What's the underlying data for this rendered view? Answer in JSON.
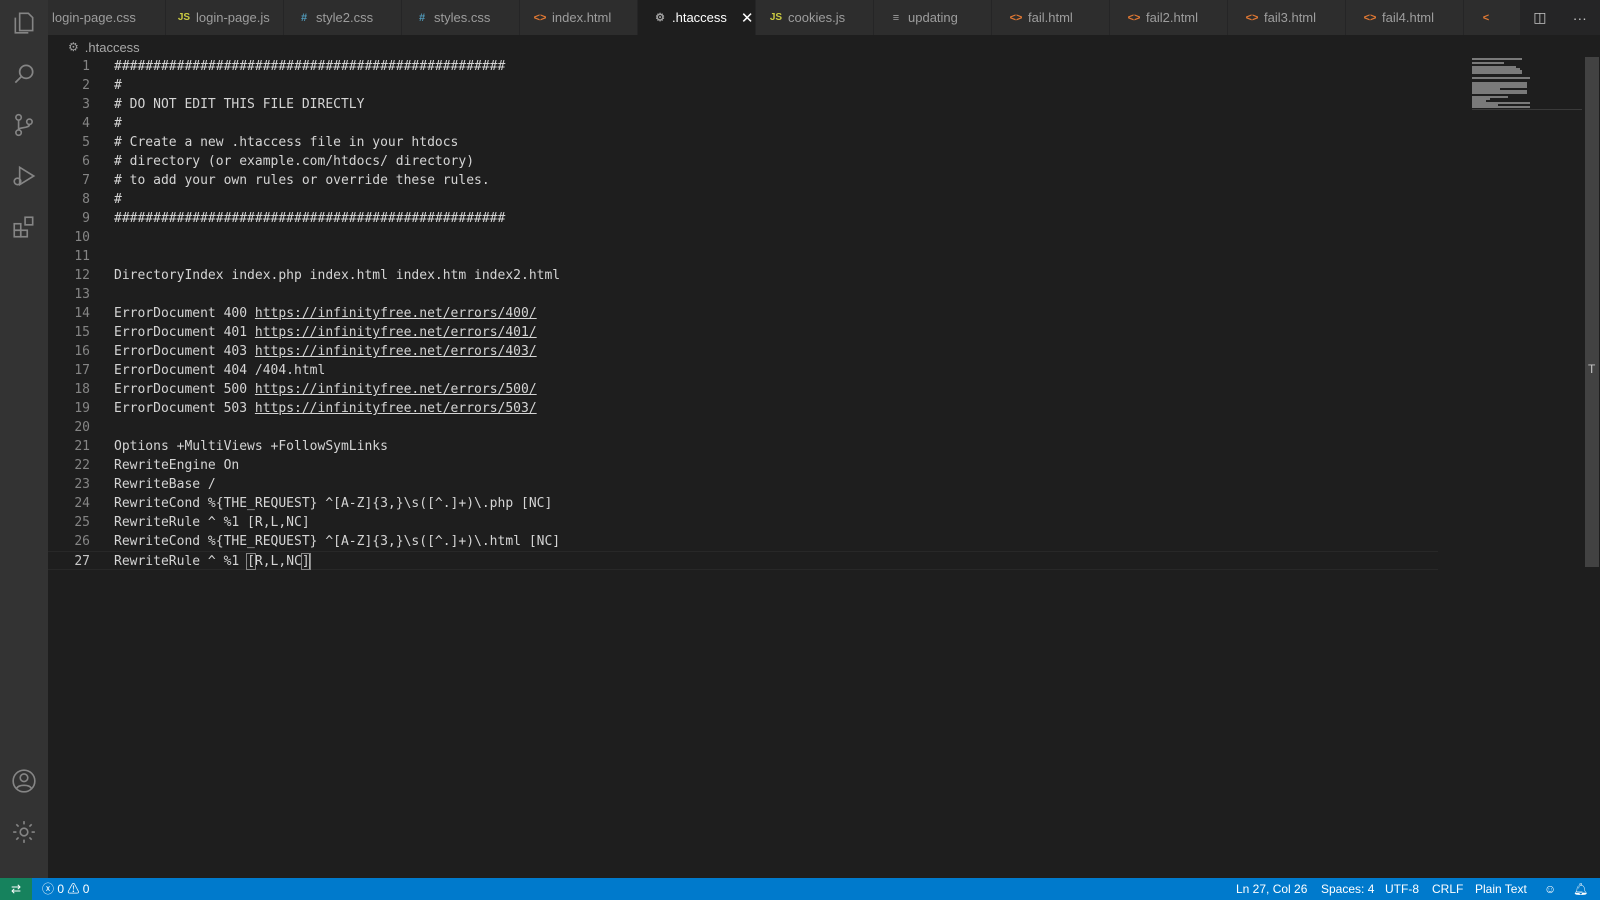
{
  "tabs": [
    {
      "label": "login-page.css",
      "icon": "css"
    },
    {
      "label": "login-page.js",
      "icon": "js"
    },
    {
      "label": "style2.css",
      "icon": "css"
    },
    {
      "label": "styles.css",
      "icon": "css"
    },
    {
      "label": "index.html",
      "icon": "html"
    },
    {
      "label": ".htaccess",
      "icon": "gear",
      "active": true
    },
    {
      "label": "cookies.js",
      "icon": "js"
    },
    {
      "label": "updating",
      "icon": "lines"
    },
    {
      "label": "fail.html",
      "icon": "html"
    },
    {
      "label": "fail2.html",
      "icon": "html"
    },
    {
      "label": "fail3.html",
      "icon": "html"
    },
    {
      "label": "fail4.html",
      "icon": "html"
    }
  ],
  "breadcrumb": {
    "file": ".htaccess"
  },
  "editor": {
    "lines": [
      {
        "n": "1",
        "text": "##################################################"
      },
      {
        "n": "2",
        "text": "#"
      },
      {
        "n": "3",
        "text": "# DO NOT EDIT THIS FILE DIRECTLY"
      },
      {
        "n": "4",
        "text": "#"
      },
      {
        "n": "5",
        "text": "# Create a new .htaccess file in your htdocs"
      },
      {
        "n": "6",
        "text": "# directory (or example.com/htdocs/ directory)"
      },
      {
        "n": "7",
        "text": "# to add your own rules or override these rules."
      },
      {
        "n": "8",
        "text": "#"
      },
      {
        "n": "9",
        "text": "##################################################"
      },
      {
        "n": "10",
        "text": ""
      },
      {
        "n": "11",
        "text": ""
      },
      {
        "n": "12",
        "text": "DirectoryIndex index.php index.html index.htm index2.html"
      },
      {
        "n": "13",
        "text": ""
      },
      {
        "n": "14",
        "text": "ErrorDocument 400 ",
        "link": "https://infinityfree.net/errors/400/"
      },
      {
        "n": "15",
        "text": "ErrorDocument 401 ",
        "link": "https://infinityfree.net/errors/401/"
      },
      {
        "n": "16",
        "text": "ErrorDocument 403 ",
        "link": "https://infinityfree.net/errors/403/"
      },
      {
        "n": "17",
        "text": "ErrorDocument 404 /404.html"
      },
      {
        "n": "18",
        "text": "ErrorDocument 500 ",
        "link": "https://infinityfree.net/errors/500/"
      },
      {
        "n": "19",
        "text": "ErrorDocument 503 ",
        "link": "https://infinityfree.net/errors/503/"
      },
      {
        "n": "20",
        "text": ""
      },
      {
        "n": "21",
        "text": "Options +MultiViews +FollowSymLinks"
      },
      {
        "n": "22",
        "text": "RewriteEngine On"
      },
      {
        "n": "23",
        "text": "RewriteBase /"
      },
      {
        "n": "24",
        "text": "RewriteCond %{THE_REQUEST} ^[A-Z]{3,}\\s([^.]+)\\.php [NC]"
      },
      {
        "n": "25",
        "text": "RewriteRule ^ %1 [R,L,NC]"
      },
      {
        "n": "26",
        "text": "RewriteCond %{THE_REQUEST} ^[A-Z]{3,}\\s([^.]+)\\.html [NC]"
      },
      {
        "n": "27",
        "text": "RewriteRule ^ %1 ",
        "bracket_open": "[",
        "bracket_inner": "R,L,NC",
        "bracket_close": "]",
        "current": true
      }
    ]
  },
  "status": {
    "errors": "0",
    "warnings": "0",
    "position": "Ln 27, Col 26",
    "spaces": "Spaces: 4",
    "encoding": "UTF-8",
    "eol": "CRLF",
    "language": "Plain Text"
  },
  "colors": {
    "statusbar": "#007acc",
    "remote": "#16825d",
    "editor_bg": "#1e1e1e",
    "activity_bg": "#333333"
  }
}
